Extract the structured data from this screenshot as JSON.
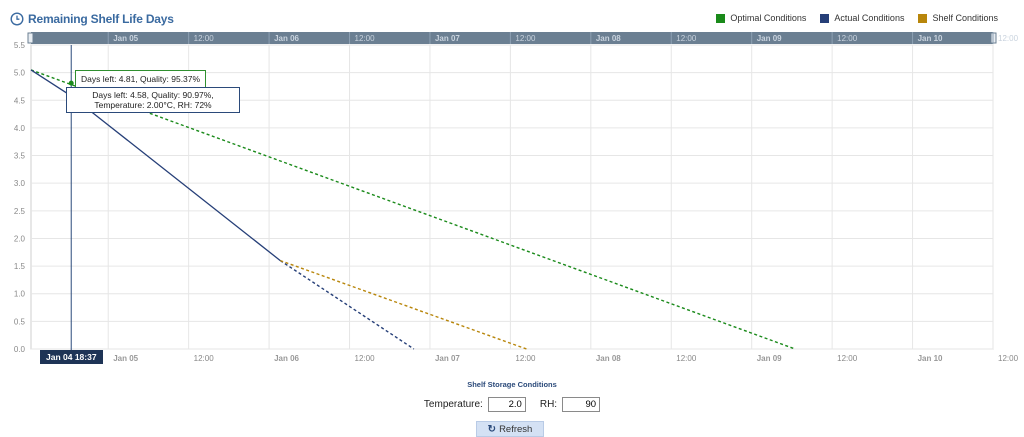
{
  "header": {
    "title": "Remaining Shelf Life Days",
    "clock_icon": "clock-icon"
  },
  "legend": [
    {
      "label": "Optimal Conditions",
      "color": "#1a8a1a"
    },
    {
      "label": "Actual Conditions",
      "color": "#263f78"
    },
    {
      "label": "Shelf Conditions",
      "color": "#b8860b"
    }
  ],
  "tooltips": {
    "optimal": "Days left: 4.81, Quality: 95.37%",
    "actual_line1": "Days left: 4.58, Quality: 90.97%,",
    "actual_line2": "Temperature: 2.00°C, RH: 72%"
  },
  "crosshair_label": "Jan 04 18:37",
  "storage": {
    "title": "Shelf Storage Conditions",
    "temperature_label": "Temperature:",
    "temperature_value": "2.0",
    "rh_label": "RH:",
    "rh_value": "90",
    "refresh_label": "Refresh"
  },
  "chart_data": {
    "type": "line",
    "title": "Remaining Shelf Life Days",
    "xlabel": "",
    "ylabel": "",
    "x_ticks": [
      {
        "label": "Jan 05",
        "major": true,
        "x": 0.0
      },
      {
        "label": "12:00",
        "major": false,
        "x": 0.5
      },
      {
        "label": "Jan 06",
        "major": true,
        "x": 1.0
      },
      {
        "label": "12:00",
        "major": false,
        "x": 1.5
      },
      {
        "label": "Jan 07",
        "major": true,
        "x": 2.0
      },
      {
        "label": "12:00",
        "major": false,
        "x": 2.5
      },
      {
        "label": "Jan 08",
        "major": true,
        "x": 3.0
      },
      {
        "label": "12:00",
        "major": false,
        "x": 3.5
      },
      {
        "label": "Jan 09",
        "major": true,
        "x": 4.0
      },
      {
        "label": "12:00",
        "major": false,
        "x": 4.5
      },
      {
        "label": "Jan 10",
        "major": true,
        "x": 5.0
      },
      {
        "label": "12:00",
        "major": false,
        "x": 5.5
      }
    ],
    "x_range": [
      -0.48,
      5.5
    ],
    "y_ticks": [
      "0.0",
      "0.5",
      "1.0",
      "1.5",
      "2.0",
      "2.5",
      "3.0",
      "3.5",
      "4.0",
      "4.5",
      "5.0",
      "5.5"
    ],
    "ylim": [
      0,
      5.5
    ],
    "grid": true,
    "legend_position": "top-right",
    "crosshair_x": -0.23,
    "series": [
      {
        "name": "Optimal Conditions",
        "color": "#1a8a1a",
        "dash": true,
        "points": [
          [
            -0.48,
            5.05
          ],
          [
            4.27,
            0.0
          ]
        ]
      },
      {
        "name": "Actual Conditions",
        "color": "#263f78",
        "dash": false,
        "points": [
          [
            -0.48,
            5.05
          ],
          [
            -0.23,
            4.58
          ],
          [
            1.07,
            1.6
          ]
        ]
      },
      {
        "name": "Actual Conditions",
        "color": "#263f78",
        "dash": true,
        "points": [
          [
            1.07,
            1.6
          ],
          [
            1.9,
            0.0
          ]
        ]
      },
      {
        "name": "Shelf Conditions",
        "color": "#b8860b",
        "dash": true,
        "points": [
          [
            1.07,
            1.6
          ],
          [
            2.6,
            0.0
          ]
        ]
      }
    ],
    "highlight_points": [
      {
        "x": -0.23,
        "y": 4.81,
        "color": "#1a8a1a"
      },
      {
        "x": -0.23,
        "y": 4.58,
        "color": "#263f78"
      }
    ]
  }
}
